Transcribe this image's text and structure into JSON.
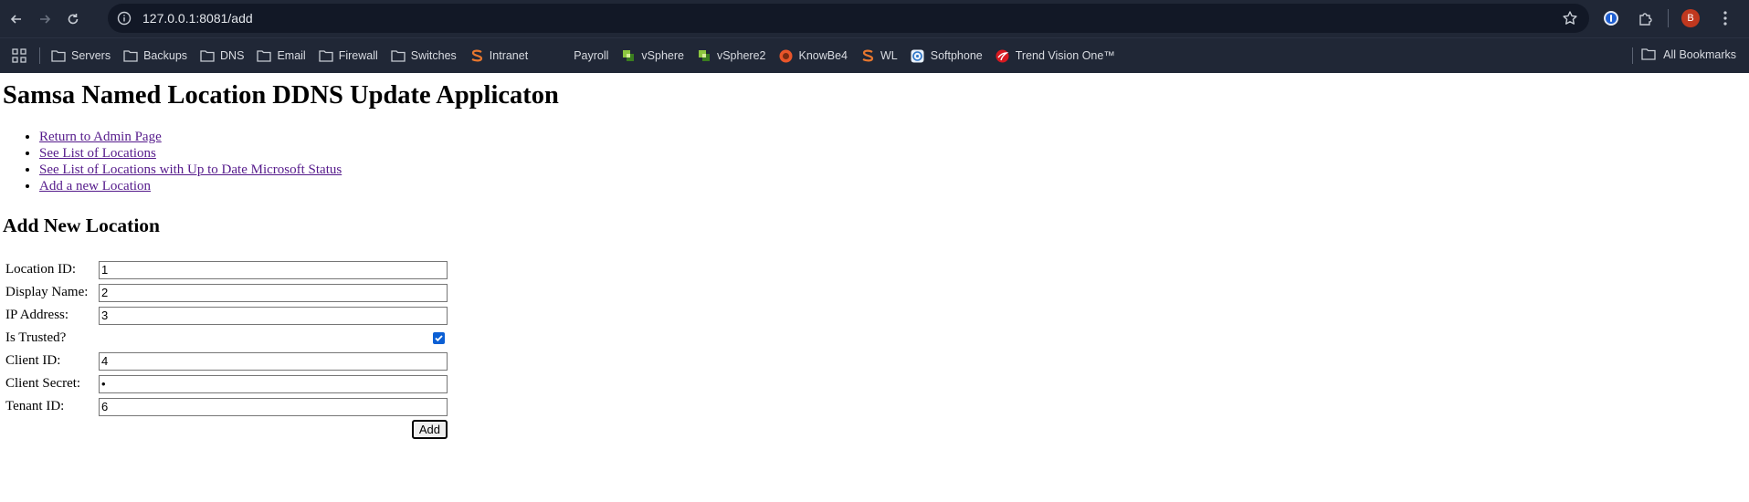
{
  "browser": {
    "url": "127.0.0.1:8081/add",
    "avatar_letter": "B",
    "bookmarks": [
      {
        "label": "Servers",
        "icon": "folder-icon"
      },
      {
        "label": "Backups",
        "icon": "folder-icon"
      },
      {
        "label": "DNS",
        "icon": "folder-icon"
      },
      {
        "label": "Email",
        "icon": "folder-icon"
      },
      {
        "label": "Firewall",
        "icon": "folder-icon"
      },
      {
        "label": "Switches",
        "icon": "folder-icon"
      },
      {
        "label": "Intranet",
        "icon": "s-logo-icon"
      },
      {
        "label": "Payroll",
        "icon": "blank-icon"
      },
      {
        "label": "vSphere",
        "icon": "vsphere-icon"
      },
      {
        "label": "vSphere2",
        "icon": "vsphere-icon"
      },
      {
        "label": "KnowBe4",
        "icon": "knowbe4-icon"
      },
      {
        "label": "WL",
        "icon": "s-logo-icon"
      },
      {
        "label": "Softphone",
        "icon": "softphone-icon"
      },
      {
        "label": "Trend Vision One™",
        "icon": "trend-icon"
      }
    ],
    "all_bookmarks_label": "All Bookmarks"
  },
  "page": {
    "title": "Samsa Named Location DDNS Update Applicaton",
    "nav_links": [
      "Return to Admin Page",
      "See List of Locations",
      "See List of Locations with Up to Date Microsoft Status",
      "Add a new Location"
    ],
    "form_heading": "Add New Location",
    "fields": {
      "location_id": {
        "label": "Location ID:",
        "value": "1"
      },
      "display_name": {
        "label": "Display Name:",
        "value": "2"
      },
      "ip_address": {
        "label": "IP Address:",
        "value": "3"
      },
      "is_trusted": {
        "label": "Is Trusted?",
        "checked": true
      },
      "client_id": {
        "label": "Client ID:",
        "value": "4"
      },
      "client_secret": {
        "label": "Client Secret:",
        "value": "•"
      },
      "tenant_id": {
        "label": "Tenant ID:",
        "value": "6"
      }
    },
    "submit_label": "Add"
  },
  "colors": {
    "chrome_bg": "#202736",
    "omnibox_bg": "#121826",
    "link_visited": "#551a8b",
    "checkbox_accent": "#0b5fd4",
    "avatar_bg": "#c0381f"
  }
}
